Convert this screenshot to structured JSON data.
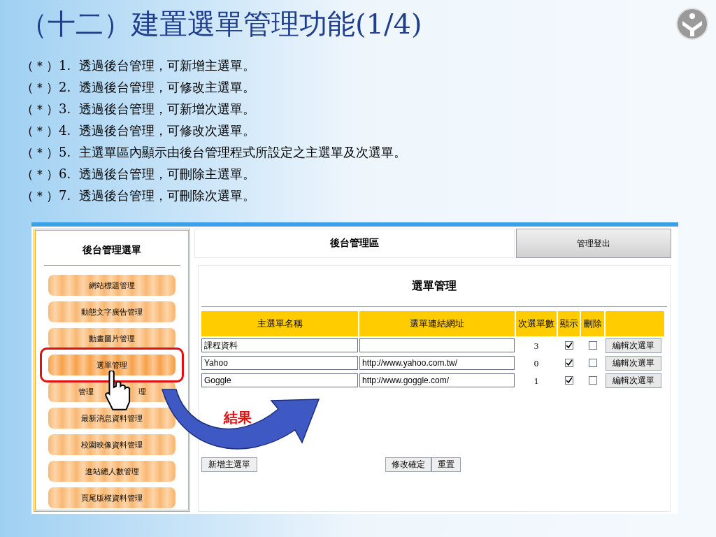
{
  "slide": {
    "title": "（十二）建置選單管理功能(1/4)",
    "bullets": [
      "（＊）1.  透過後台管理，可新增主選單。",
      "（＊）2.  透過後台管理，可修改主選單。",
      "（＊）3.  透過後台管理，可新增次選單。",
      "（＊）4.  透過後台管理，可修改次選單。",
      "（＊）5.  主選單區內顯示由後台管理程式所設定之主選單及次選單。",
      "（＊）6.  透過後台管理，可刪除主選單。",
      "（＊）7.  透過後台管理，可刪除次選單。"
    ],
    "annotation": "結果"
  },
  "sidebar": {
    "title": "後台管理選單",
    "items": [
      {
        "label_parts": [
          "網站標題管理"
        ],
        "selected": false
      },
      {
        "label_parts": [
          "動態文字廣告管理"
        ],
        "selected": false
      },
      {
        "label_parts": [
          "動畫圖片管理"
        ],
        "selected": false
      },
      {
        "label_parts": [
          "選單管理"
        ],
        "selected": true
      },
      {
        "label_parts": [
          "管理",
          "理"
        ],
        "selected": false
      },
      {
        "label_parts": [
          "最新消息資料管理"
        ],
        "selected": false
      },
      {
        "label_parts": [
          "校園映像資料管理"
        ],
        "selected": false
      },
      {
        "label_parts": [
          "進站總人數管理"
        ],
        "selected": false
      },
      {
        "label_parts": [
          "頁尾版權資料管理"
        ],
        "selected": false
      }
    ]
  },
  "header": {
    "title": "後台管理區",
    "logout_button": "管理登出"
  },
  "panel": {
    "title": "選單管理",
    "columns": [
      "主選單名稱",
      "選單連結網址",
      "次選單數",
      "顯示",
      "刪除"
    ],
    "rows": [
      {
        "name": "課程資料",
        "url": "",
        "count": "3",
        "show": true,
        "delete": false,
        "edit_button": "編輯次選單"
      },
      {
        "name": "Yahoo",
        "url": "http://www.yahoo.com.tw/",
        "count": "0",
        "show": true,
        "delete": false,
        "edit_button": "編輯次選單"
      },
      {
        "name": "Goggle",
        "url": "http://www.goggle.com/",
        "count": "1",
        "show": true,
        "delete": false,
        "edit_button": "編輯次選單"
      }
    ],
    "add_button": "新增主選單",
    "confirm_button": "修改確定",
    "reset_button": "重置"
  }
}
